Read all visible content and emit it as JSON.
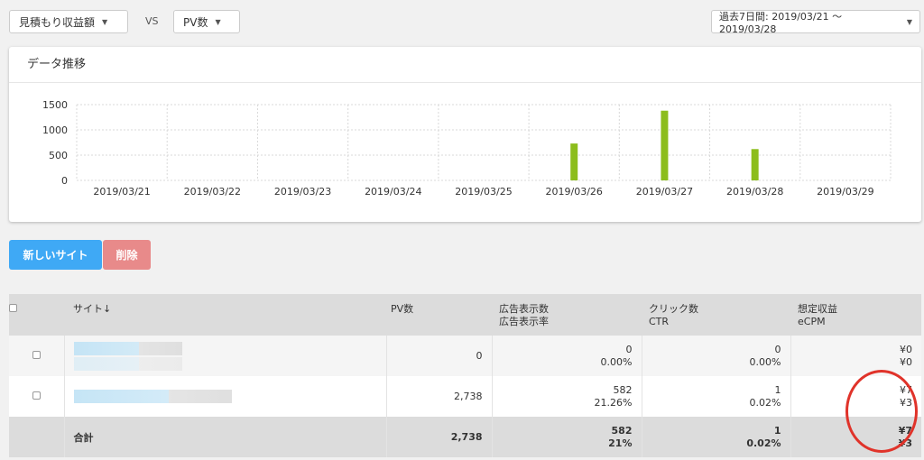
{
  "toolbar": {
    "metric1": "見積もり収益額",
    "vs": "VS",
    "metric2": "PV数",
    "date_range": "過去7日間: 2019/03/21 〜 2019/03/28"
  },
  "chart_card": {
    "title": "データ推移"
  },
  "chart_data": {
    "type": "bar",
    "categories": [
      "2019/03/21",
      "2019/03/22",
      "2019/03/23",
      "2019/03/24",
      "2019/03/25",
      "2019/03/26",
      "2019/03/27",
      "2019/03/28",
      "2019/03/29"
    ],
    "values": [
      0,
      0,
      0,
      0,
      0,
      730,
      1380,
      620,
      0
    ],
    "yticks": [
      0,
      500,
      1000,
      1500
    ],
    "ylim": [
      0,
      1500
    ],
    "title": "",
    "xlabel": "",
    "ylabel": "",
    "grid": true,
    "bar_color": "#8cbd1c"
  },
  "actions": {
    "new_site": "新しいサイト",
    "delete": "削除"
  },
  "table": {
    "headers": {
      "site": "サイト↓",
      "pv": "PV数",
      "imp1": "広告表示数",
      "imp2": "広告表示率",
      "click1": "クリック数",
      "click2": "CTR",
      "rev1": "想定収益",
      "rev2": "eCPM"
    },
    "rows": [
      {
        "pv": "0",
        "imp": "0",
        "imp_rate": "0.00%",
        "clicks": "0",
        "ctr": "0.00%",
        "revenue": "¥0",
        "ecpm": "¥0"
      },
      {
        "pv": "2,738",
        "imp": "582",
        "imp_rate": "21.26%",
        "clicks": "1",
        "ctr": "0.02%",
        "revenue": "¥7",
        "ecpm": "¥3"
      }
    ],
    "total": {
      "label": "合計",
      "pv": "2,738",
      "imp": "582",
      "imp_rate": "21%",
      "clicks": "1",
      "ctr": "0.02%",
      "revenue": "¥7",
      "ecpm": "¥3"
    }
  },
  "colors": {
    "primary": "#3fa9f5",
    "danger": "#e88a8a",
    "annotation": "#e0332a"
  }
}
